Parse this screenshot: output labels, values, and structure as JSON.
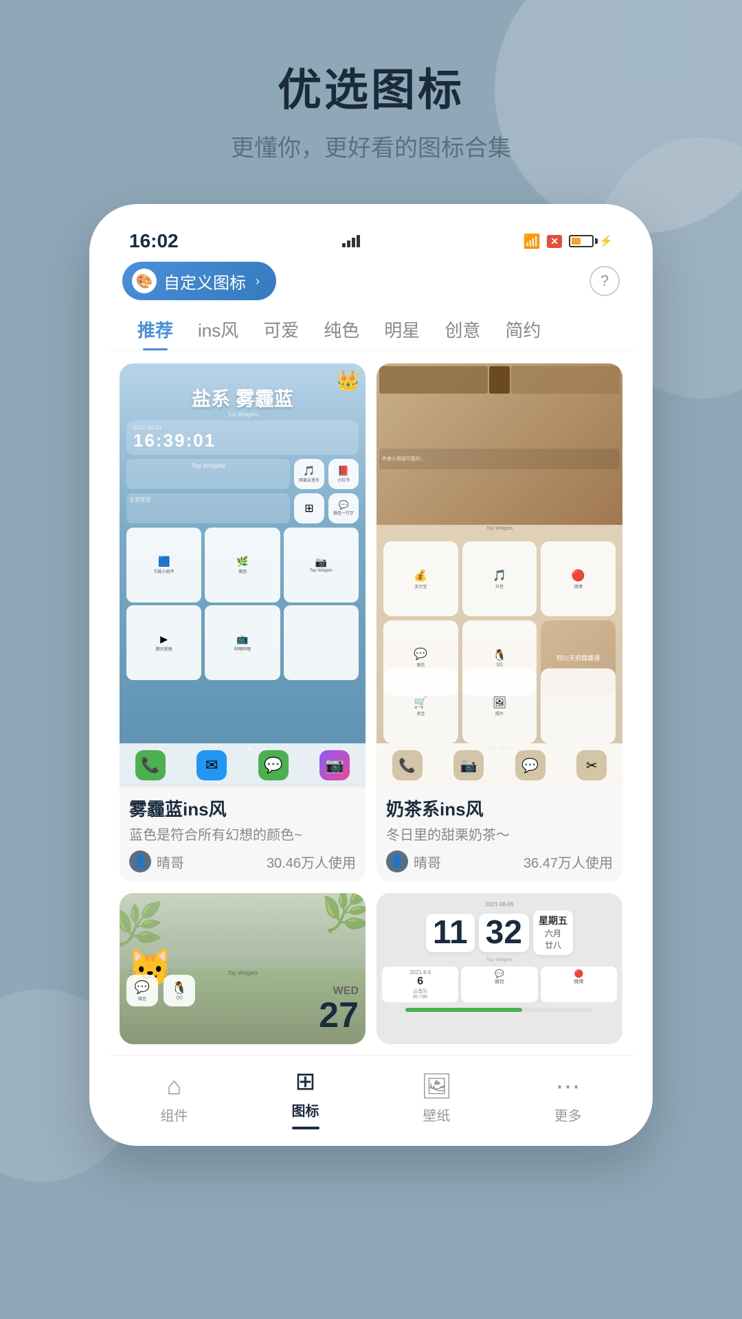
{
  "page": {
    "title": "优选图标",
    "subtitle": "更懂你，更好看的图标合集"
  },
  "status_bar": {
    "time": "16:02",
    "signal": "signal",
    "wifi": "WiFi",
    "battery": "45%"
  },
  "custom_icon_btn": {
    "label": "自定义图标",
    "chevron": "›"
  },
  "tabs": [
    {
      "id": "tuijian",
      "label": "推荐",
      "active": true
    },
    {
      "id": "ins",
      "label": "ins风",
      "active": false
    },
    {
      "id": "cute",
      "label": "可爱",
      "active": false
    },
    {
      "id": "pure",
      "label": "纯色",
      "active": false
    },
    {
      "id": "star",
      "label": "明星",
      "active": false
    },
    {
      "id": "creative",
      "label": "创意",
      "active": false
    },
    {
      "id": "simple",
      "label": "简约",
      "active": false
    }
  ],
  "themes": [
    {
      "id": "blue_mist",
      "name": "雾霾蓝ins风",
      "desc": "蓝色是符合所有幻想的颜色~",
      "author": "晴哥",
      "usage": "30.46万人使用",
      "style_label": "盐系 雾霾蓝",
      "crown": true
    },
    {
      "id": "milk_tea",
      "name": "奶茶系ins风",
      "desc": "冬日里的甜栗奶茶～",
      "author": "晴哥",
      "usage": "36.47万人使用",
      "crown": false
    }
  ],
  "bottom_cards": [
    {
      "id": "cat_theme",
      "preview_type": "cat"
    },
    {
      "id": "calendar_theme",
      "preview_type": "calendar",
      "date": "2021-08-06",
      "day": "11",
      "month": "32",
      "weekday": "星期五",
      "lunar": "六月\n廿八",
      "wed": "WED",
      "num": "27"
    }
  ],
  "bottom_nav": [
    {
      "id": "widget",
      "label": "组件",
      "icon": "⌂",
      "active": false
    },
    {
      "id": "icon",
      "label": "图标",
      "icon": "⊞",
      "active": true
    },
    {
      "id": "wallpaper",
      "label": "壁纸",
      "icon": "🖼",
      "active": false
    },
    {
      "id": "more",
      "label": "更多",
      "icon": "⋯",
      "active": false
    }
  ],
  "icons": {
    "phone": "📞",
    "mail": "✉",
    "message": "💬",
    "camera": "📷",
    "wechat": "💬",
    "qq": "🐧",
    "alipay": "💰",
    "tiktok": "♪",
    "weibo": "🔴",
    "netease": "🎵",
    "taobao": "🛒",
    "photos": "🖼",
    "bilibili": "📺",
    "tencent": "▶",
    "xiaohongshu": "📕",
    "netease_music": "🎵"
  }
}
